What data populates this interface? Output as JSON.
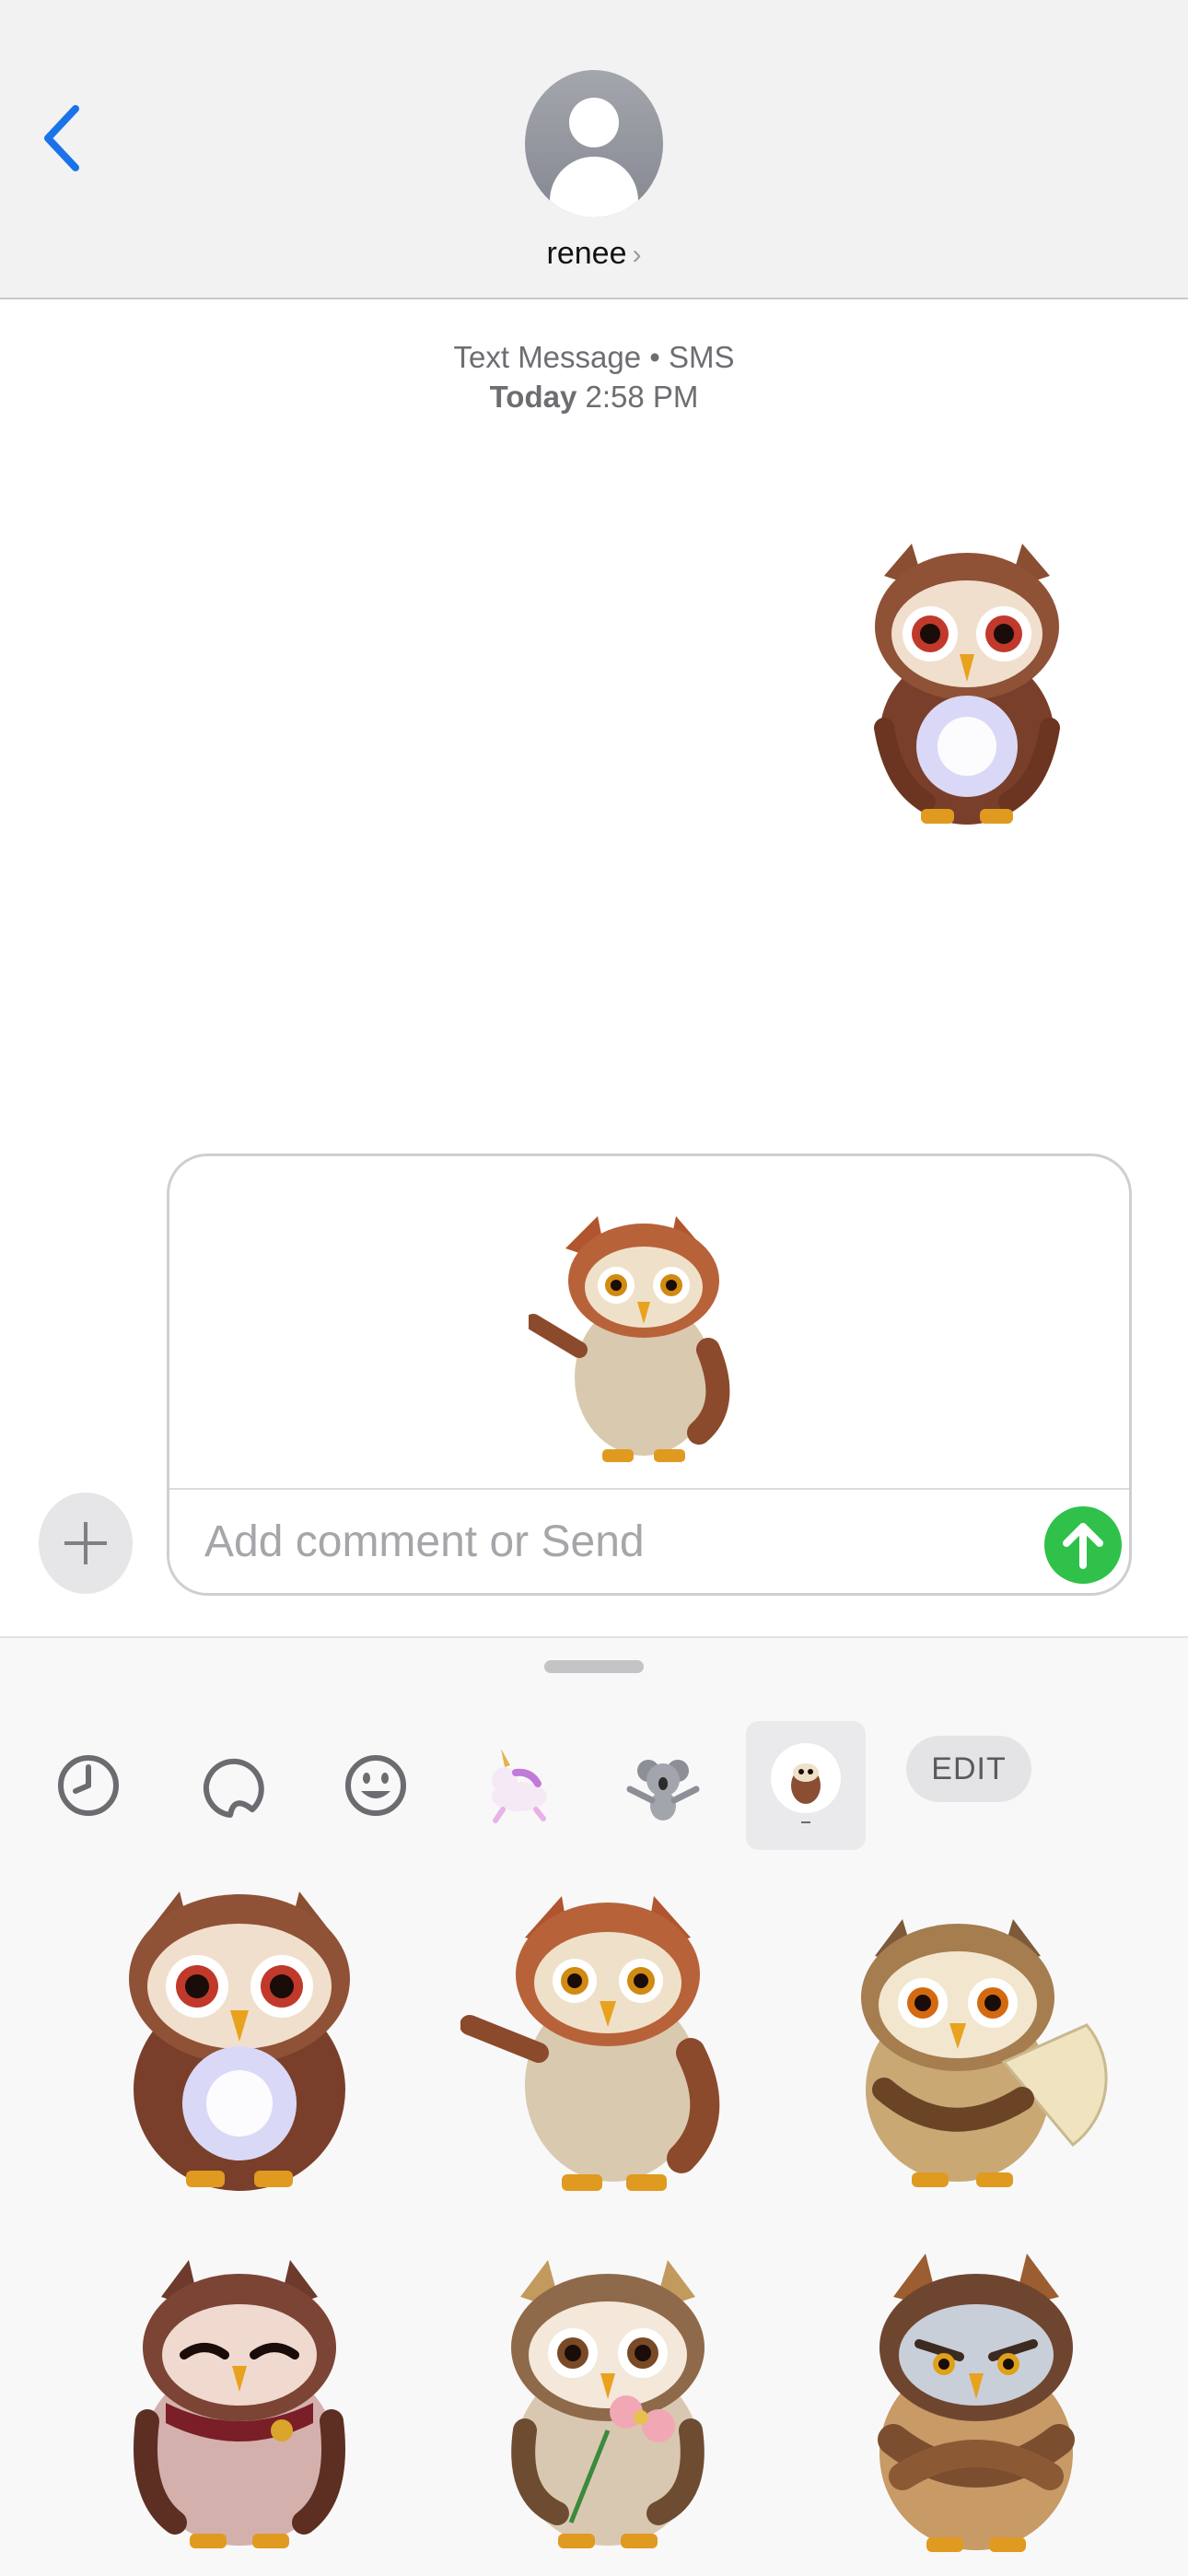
{
  "header": {
    "contact_name": "renee",
    "contact_chevron": "›",
    "back_icon": "chevron-left-icon"
  },
  "thread": {
    "service_label": "Text Message • SMS",
    "day_label": "Today",
    "time_label": "2:58 PM"
  },
  "compose": {
    "placeholder": "Add comment or Send",
    "value": ""
  },
  "drawer": {
    "tabs": [
      {
        "icon": "recents-clock-icon"
      },
      {
        "icon": "stickers-peel-icon"
      },
      {
        "icon": "emoji-smiley-icon"
      },
      {
        "icon": "unicorn-sticker-pack-icon"
      },
      {
        "icon": "koala-sticker-pack-icon"
      },
      {
        "icon": "owl-sticker-pack-icon",
        "selected": true
      }
    ],
    "edit_label": "EDIT",
    "stickers": [
      {
        "name": "owl-crystal-ball-sticker"
      },
      {
        "name": "owl-pointing-sticker"
      },
      {
        "name": "owl-fan-sticker"
      },
      {
        "name": "owl-scarf-sticker"
      },
      {
        "name": "owl-flower-sticker"
      },
      {
        "name": "owl-arms-crossed-sticker"
      }
    ]
  },
  "colors": {
    "accent": "#1a73e8",
    "send": "#2fc14a",
    "header_bg": "#f2f2f2"
  }
}
